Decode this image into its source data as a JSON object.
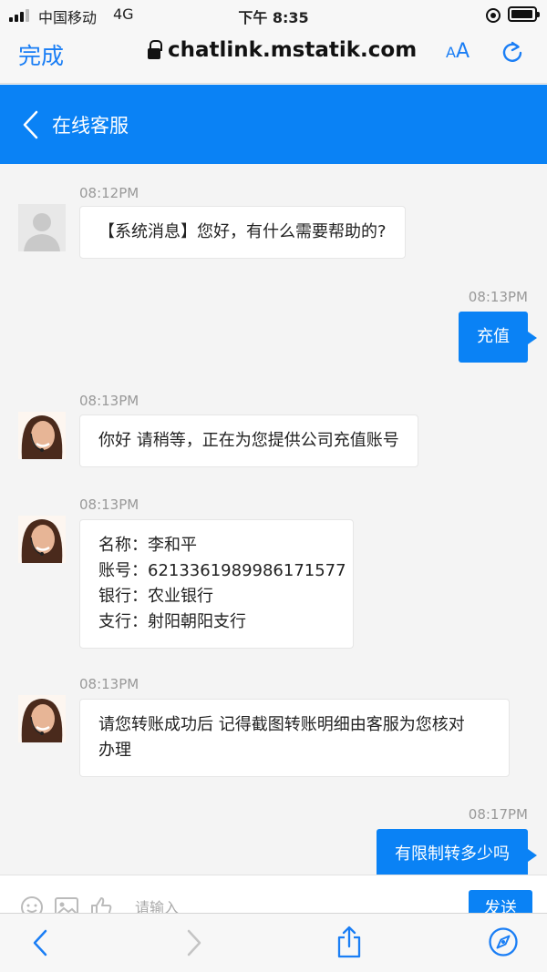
{
  "status_bar": {
    "carrier": "中国移动",
    "network": "4G",
    "time": "下午 8:35",
    "battery_level": 0.95
  },
  "browser": {
    "done_label": "完成",
    "url": "chatlink.mstatik.com",
    "text_size_small": "A",
    "text_size_large": "A"
  },
  "app_header": {
    "title": "在线客服"
  },
  "messages": [
    {
      "time": "08:12PM",
      "lines": [
        "【系统消息】您好，有什么需要帮助的?"
      ]
    },
    {
      "time": "08:13PM",
      "lines": [
        "充值"
      ]
    },
    {
      "time": "08:13PM",
      "lines": [
        "你好 请稍等，正在为您提供公司充值账号"
      ]
    },
    {
      "time": "08:13PM",
      "lines": [
        " 名称：李和平",
        "账号：6213361989986171577",
        "银行：农业银行",
        "支行：射阳朝阳支行"
      ]
    },
    {
      "time": "08:13PM",
      "lines": [
        "请您转账成功后 记得截图转账明细由客服为您核对",
        "办理"
      ]
    },
    {
      "time": "08:17PM",
      "lines": [
        "有限制转多少吗"
      ]
    }
  ],
  "input_bar": {
    "placeholder": "请输入",
    "send_label": "发送"
  },
  "colors": {
    "accent": "#0a82f5",
    "background": "#f4f4f4",
    "bubble_in": "#ffffff"
  },
  "icons": [
    "signal-icon",
    "orientation-lock-icon",
    "battery-icon",
    "lock-icon",
    "reload-icon",
    "back-chevron-icon",
    "emoji-icon",
    "image-icon",
    "thumbs-up-icon",
    "share-icon",
    "compass-icon",
    "forward-icon"
  ]
}
